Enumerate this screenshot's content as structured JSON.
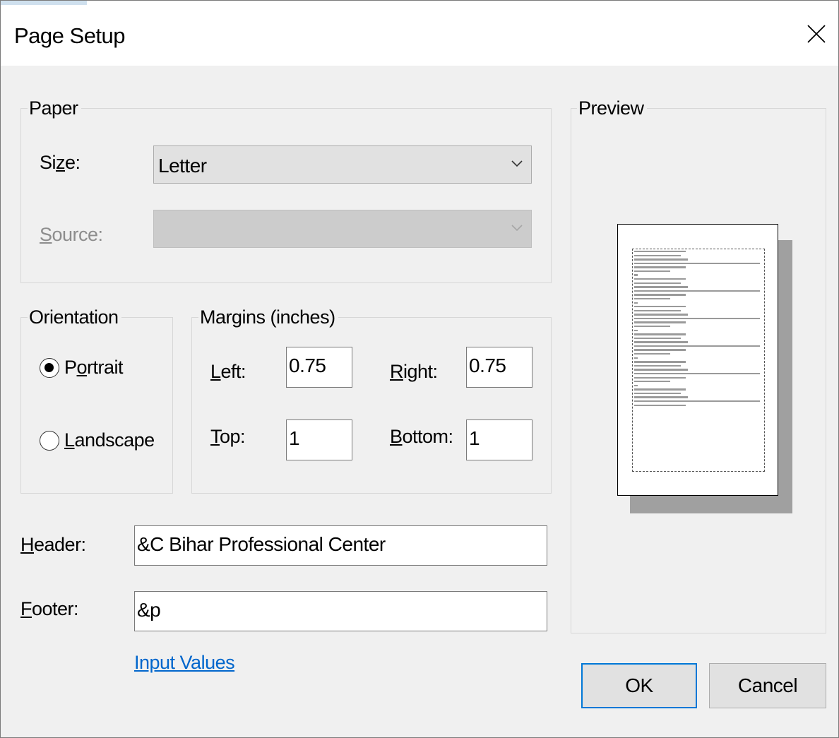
{
  "dialog": {
    "title": "Page Setup"
  },
  "paper": {
    "legend": "Paper",
    "size_label_pre": "Si",
    "size_label_key": "z",
    "size_label_post": "e:",
    "size_value": "Letter",
    "source_label_key": "S",
    "source_label_post": "ource:",
    "source_value": ""
  },
  "orientation": {
    "legend": "Orientation",
    "portrait_key": "P",
    "portrait_pre": "",
    "portrait_mid": "o",
    "portrait_post": "rtrait",
    "portrait_selected": true,
    "landscape_key": "L",
    "landscape_post": "andscape",
    "landscape_selected": false
  },
  "margins": {
    "legend": "Margins (inches)",
    "left_key": "L",
    "left_post": "eft:",
    "left_value": "0.75",
    "right_key": "R",
    "right_post": "ight:",
    "right_value": "0.75",
    "top_key": "T",
    "top_post": "op:",
    "top_value": "1",
    "bottom_key": "B",
    "bottom_post": "ottom:",
    "bottom_value": "1"
  },
  "header": {
    "label_key": "H",
    "label_post": "eader:",
    "value": "&C Bihar Professional Center"
  },
  "footer": {
    "label_key": "F",
    "label_post": "ooter:",
    "value": "&p"
  },
  "input_values_link": "Input Values",
  "preview": {
    "legend": "Preview"
  },
  "buttons": {
    "ok": "OK",
    "cancel": "Cancel"
  },
  "icons": {
    "close": "close-icon",
    "dropdown": "chevron-down-icon"
  },
  "colors": {
    "link": "#0066cc",
    "default_button_border": "#0078d7"
  }
}
